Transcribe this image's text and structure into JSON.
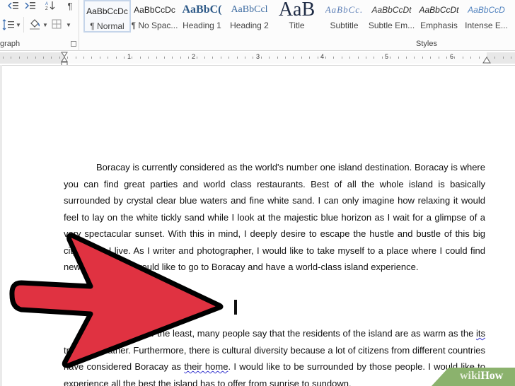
{
  "ribbon": {
    "paragraph_group_label": "graph",
    "styles_group_label": "Styles",
    "styles": [
      {
        "sample": "AaBbCcDc",
        "name": "¶ Normal",
        "selected": true
      },
      {
        "sample": "AaBbCcDc",
        "name": "¶ No Spac..."
      },
      {
        "sample": "AaBbC(",
        "name": "Heading 1"
      },
      {
        "sample": "AaBbCcl",
        "name": "Heading 2"
      },
      {
        "sample": "AaB",
        "name": "Title"
      },
      {
        "sample": "AaBbCc.",
        "name": "Subtitle"
      },
      {
        "sample": "AaBbCcDt",
        "name": "Subtle Em..."
      },
      {
        "sample": "AaBbCcDt",
        "name": "Emphasis"
      },
      {
        "sample": "AaBbCcD",
        "name": "Intense E..."
      }
    ],
    "icons": {
      "decrease_indent": "decrease-indent-icon",
      "increase_indent": "increase-indent-icon",
      "sort": "sort-az-icon",
      "show_marks": "pilcrow-icon",
      "line_spacing": "line-spacing-icon",
      "shading": "paint-bucket-icon",
      "borders": "borders-icon"
    }
  },
  "ruler": {
    "numbers": [
      "1",
      "2",
      "3",
      "4",
      "5",
      "6"
    ]
  },
  "document": {
    "paragraph1": "Boracay is currently considered as the world's number one island destination.  Boracay is where you can find great parties and world class restaurants.  Best of all the whole island is basically surrounded by crystal clear blue waters and fine white sand.  I can only imagine how relaxing it would feel to lay on the white tickly sand while I look at the majestic blue horizon as I wait for a glimpse of a very spectacular sunset.  With this in mind, I deeply desire to escape the hustle and bustle of this big city where I live.  As I writer and photographer, I would like to take myself to a place where I could find new inspiration.  I would like to go to Boracay and have a world-class island experience.",
    "paragraph2_parts": {
      "a": "Last but never the least, many people say that the residents of the island are as warm as the ",
      "its": "its",
      "b": " tropical weather.  Furthermore, there is cultural diversity because a lot of citizens from different countries have considered Boracay as ",
      "their_home": "their  home",
      "c": ".  I would like to be surrounded by those people.  I would like to experience all the best the island has to offer from sunrise to sundown."
    }
  },
  "overlay": {
    "arrow_color": "#e03241",
    "watermark_wiki": "wiki",
    "watermark_how": "How",
    "watermark_bg": "#8bb26d"
  }
}
